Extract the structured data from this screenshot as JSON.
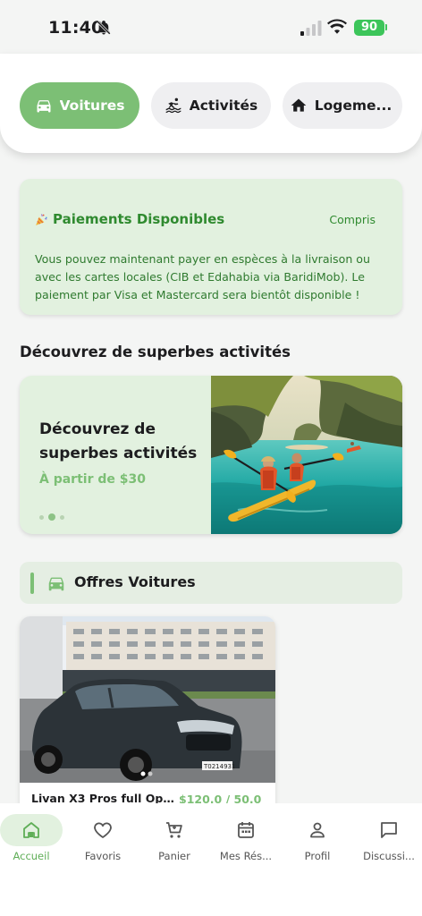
{
  "status_bar": {
    "time": "11:40",
    "battery": "90"
  },
  "categories": [
    {
      "label": "Voitures",
      "icon": "car-icon",
      "active": true
    },
    {
      "label": "Activités",
      "icon": "activity-icon",
      "active": false
    },
    {
      "label": "Logeme...",
      "icon": "home-icon",
      "active": false
    }
  ],
  "notice": {
    "title": "Paiements Disponibles",
    "action": "Compris",
    "body": "Vous pouvez maintenant payer en espèces à la livraison ou avec les cartes locales (CIB et Edahabia via BaridiMob). Le paiement par Visa et Mastercard sera bientôt disponible !"
  },
  "activities_section": {
    "title": "Découvrez de superbes activités"
  },
  "promo": {
    "title": "Découvrez de superbes activités",
    "subtitle": "À partir de $30",
    "dots_count": 3,
    "active_dot": 1
  },
  "offers": {
    "title": "Offres Voitures"
  },
  "car_card": {
    "name": "Livan X3 Pros full Optio...",
    "price": "$120.0 / 50.0",
    "plate": "T0214931",
    "image_dots": 2
  },
  "nav": [
    {
      "label": "Accueil",
      "icon": "home-icon",
      "active": true
    },
    {
      "label": "Favoris",
      "icon": "heart-icon",
      "active": false
    },
    {
      "label": "Panier",
      "icon": "cart-icon",
      "active": false
    },
    {
      "label": "Mes Rés...",
      "icon": "calendar-icon",
      "active": false
    },
    {
      "label": "Profil",
      "icon": "person-icon",
      "active": false
    },
    {
      "label": "Discussi...",
      "icon": "chat-icon",
      "active": false
    }
  ],
  "colors": {
    "accent": "#7cbf75",
    "accent_dark": "#2f8a2f",
    "notice_bg": "#e2f1df",
    "battery": "#3cc55a"
  }
}
